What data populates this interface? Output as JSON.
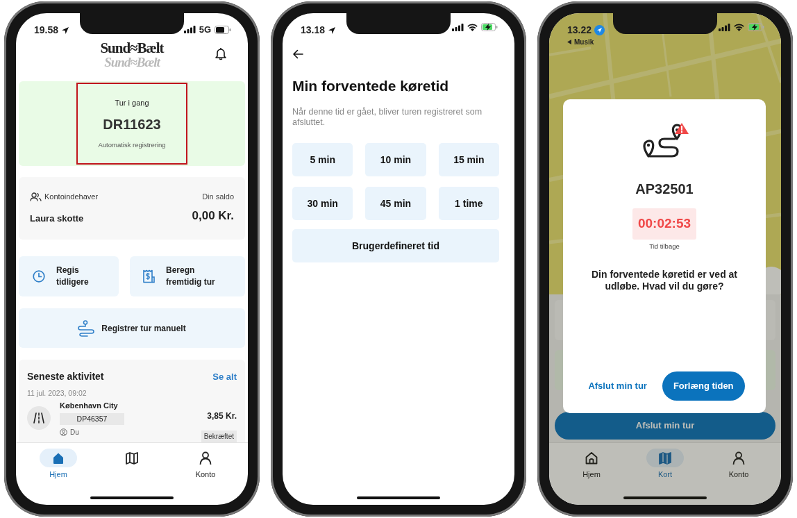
{
  "phones": [
    {
      "kind": "home",
      "status_bar": {
        "time": "19.58",
        "network": "5G",
        "battery_charging": false
      },
      "header": {
        "logo": "Sund≈Bælt",
        "logo_reflection": "Sund≈Bælt"
      },
      "trip_card": {
        "status": "Tur i gang",
        "plate": "DR11623",
        "mode": "Automatisk registrering",
        "highlighted": true
      },
      "account": {
        "label": "Kontoindehaver",
        "name": "Laura skotte",
        "balance_label": "Din saldo",
        "balance": "0,00 Kr."
      },
      "actions": [
        {
          "lines": [
            "Regis",
            "tidligere"
          ]
        },
        {
          "lines": [
            "Beregn",
            "fremtidig tur"
          ]
        }
      ],
      "manual_button": "Registrer tur manuelt",
      "activity": {
        "title": "Seneste aktivitet",
        "see_all": "Se alt",
        "date": "11 jul. 2023, 09:02",
        "place": "København City",
        "plate": "DP46357",
        "user": "Du",
        "amount": "3,85 Kr.",
        "status": "Bekræftet"
      },
      "tab_bar": [
        {
          "label": "Hjem",
          "selected": true
        },
        {
          "selected": false
        },
        {
          "label": "Konto",
          "selected": false
        }
      ]
    },
    {
      "kind": "duration",
      "status_bar": {
        "time": "13.18",
        "battery_charging": true
      },
      "title": "Min forventede køretid",
      "description": "Når denne tid er gået, bliver turen registreret som afsluttet.",
      "options": [
        "5 min",
        "10 min",
        "15 min",
        "30 min",
        "45 min",
        "1 time"
      ],
      "custom_option": "Brugerdefineret tid"
    },
    {
      "kind": "alert",
      "status_bar": {
        "time": "13.22",
        "battery_charging": true,
        "back_app": "Musik"
      },
      "end_trip_button": "Afslut min tur",
      "tab_bar": [
        {
          "label": "Hjem",
          "selected": false
        },
        {
          "label": "Kort",
          "selected": true
        },
        {
          "label": "Konto",
          "selected": false
        }
      ],
      "dialog": {
        "plate": "AP32501",
        "countdown": "00:02:53",
        "countdown_label": "Tid tilbage",
        "message": "Din forventede køretid er ved at udløbe. Hvad vil du gøre?",
        "buttons": [
          {
            "label": "Afslut min tur",
            "kind": "text"
          },
          {
            "label": "Forlæng tiden",
            "kind": "primary"
          }
        ]
      }
    }
  ]
}
